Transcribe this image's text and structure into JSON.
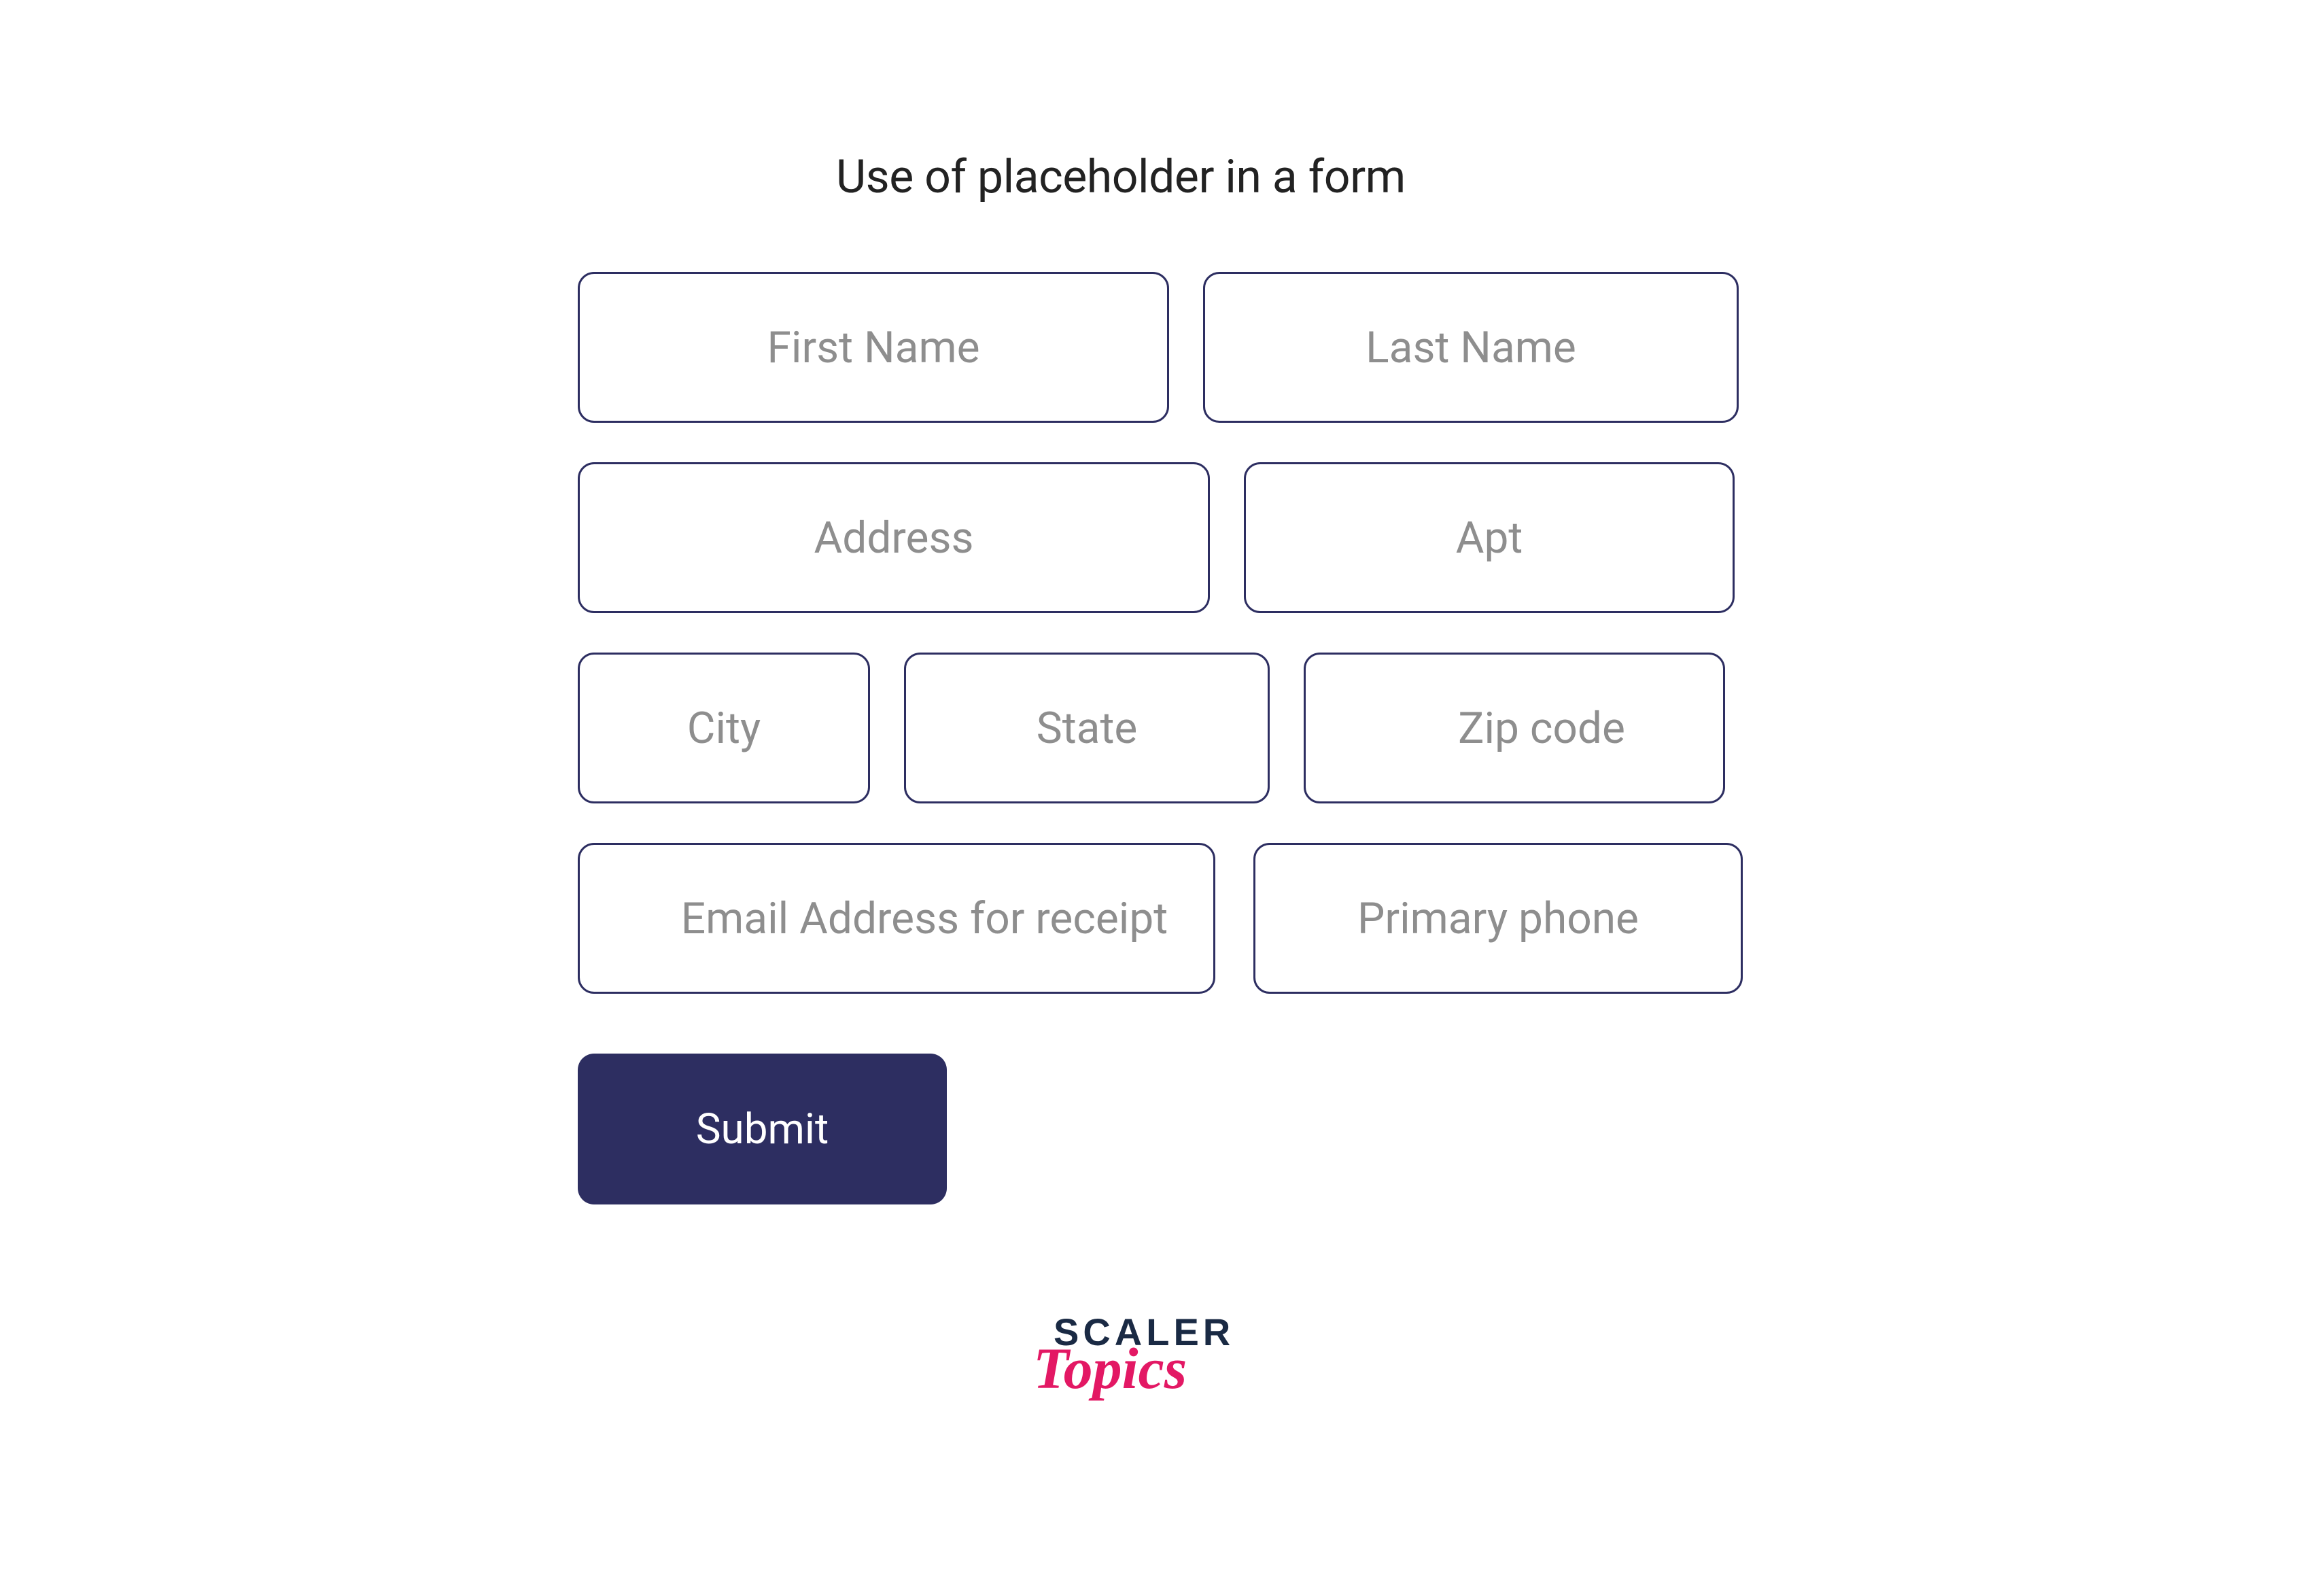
{
  "heading": "Use of placeholder in a form",
  "form": {
    "first_name_placeholder": "First Name",
    "last_name_placeholder": "Last Name",
    "address_placeholder": "Address",
    "apt_placeholder": "Apt",
    "city_placeholder": "City",
    "state_placeholder": "State",
    "zip_placeholder": "Zip code",
    "email_placeholder": "Email Address for receipt",
    "phone_placeholder": "Primary phone",
    "submit_label": "Submit"
  },
  "logo": {
    "line1": "SCALER",
    "line2": "Topics"
  },
  "colors": {
    "border": "#2d2e61",
    "button_bg": "#2d2e61",
    "placeholder": "#8e8e8e",
    "logo_dark": "#1a2a44",
    "logo_pink": "#e31864"
  }
}
